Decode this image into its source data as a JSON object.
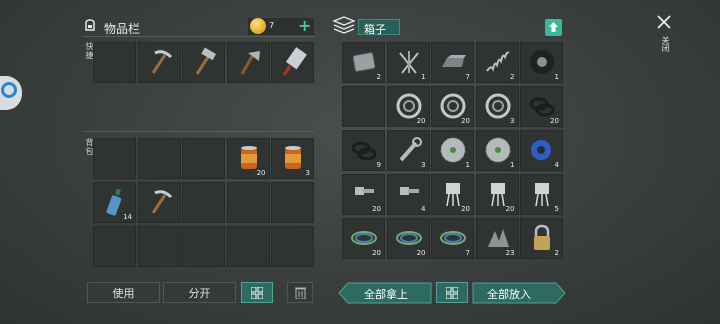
{
  "inventory": {
    "title": "物品栏",
    "coins": "7",
    "quick_label": "快捷",
    "bag_label": "背包"
  },
  "box": {
    "title": "箱子"
  },
  "close_label": "关闭",
  "buttons": {
    "use": "使用",
    "split": "分开",
    "take_all": "全部拿上",
    "put_all": "全部放入"
  },
  "quick_slots": [
    {
      "item": "empty",
      "qty": ""
    },
    {
      "item": "pickaxe-icon",
      "qty": ""
    },
    {
      "item": "hammer-icon",
      "qty": ""
    },
    {
      "item": "hatchet-icon",
      "qty": ""
    },
    {
      "item": "cleaver-icon",
      "qty": ""
    }
  ],
  "bag_slots": [
    {
      "item": "empty",
      "qty": ""
    },
    {
      "item": "empty",
      "qty": ""
    },
    {
      "item": "empty",
      "qty": ""
    },
    {
      "item": "canned-food-icon",
      "qty": "20"
    },
    {
      "item": "canned-food-icon",
      "qty": "3"
    },
    {
      "item": "water-bottle-icon",
      "qty": "14"
    },
    {
      "item": "pickaxe-icon",
      "qty": ""
    },
    {
      "item": "empty",
      "qty": ""
    },
    {
      "item": "empty",
      "qty": ""
    },
    {
      "item": "empty",
      "qty": ""
    },
    {
      "item": "empty",
      "qty": ""
    },
    {
      "item": "empty",
      "qty": ""
    },
    {
      "item": "empty",
      "qty": ""
    },
    {
      "item": "empty",
      "qty": ""
    },
    {
      "item": "empty",
      "qty": ""
    }
  ],
  "box_slots": [
    {
      "item": "metal-plate-icon",
      "qty": "2"
    },
    {
      "item": "nails-icon",
      "qty": "1"
    },
    {
      "item": "ingot-icon",
      "qty": "7"
    },
    {
      "item": "spring-icon",
      "qty": "2"
    },
    {
      "item": "tire-icon",
      "qty": "1"
    },
    {
      "item": "empty",
      "qty": ""
    },
    {
      "item": "bearing-icon",
      "qty": "20"
    },
    {
      "item": "bearing-icon",
      "qty": "20"
    },
    {
      "item": "bearing-icon",
      "qty": "3"
    },
    {
      "item": "rubber-ring-icon",
      "qty": "20"
    },
    {
      "item": "rubber-ring-icon",
      "qty": "9"
    },
    {
      "item": "wrench-icon",
      "qty": "3"
    },
    {
      "item": "saw-blade-icon",
      "qty": "1"
    },
    {
      "item": "saw-blade-icon",
      "qty": "1"
    },
    {
      "item": "duct-tape-icon",
      "qty": "4"
    },
    {
      "item": "bolt-icon",
      "qty": "20"
    },
    {
      "item": "bolt-icon",
      "qty": "4"
    },
    {
      "item": "transistor-icon",
      "qty": "20"
    },
    {
      "item": "transistor-icon",
      "qty": "20"
    },
    {
      "item": "transistor-icon",
      "qty": "5"
    },
    {
      "item": "wire-coil-icon",
      "qty": "20"
    },
    {
      "item": "wire-coil-icon",
      "qty": "20"
    },
    {
      "item": "wire-coil-icon",
      "qty": "7"
    },
    {
      "item": "scrap-icon",
      "qty": "23"
    },
    {
      "item": "padlock-icon",
      "qty": "2"
    }
  ]
}
